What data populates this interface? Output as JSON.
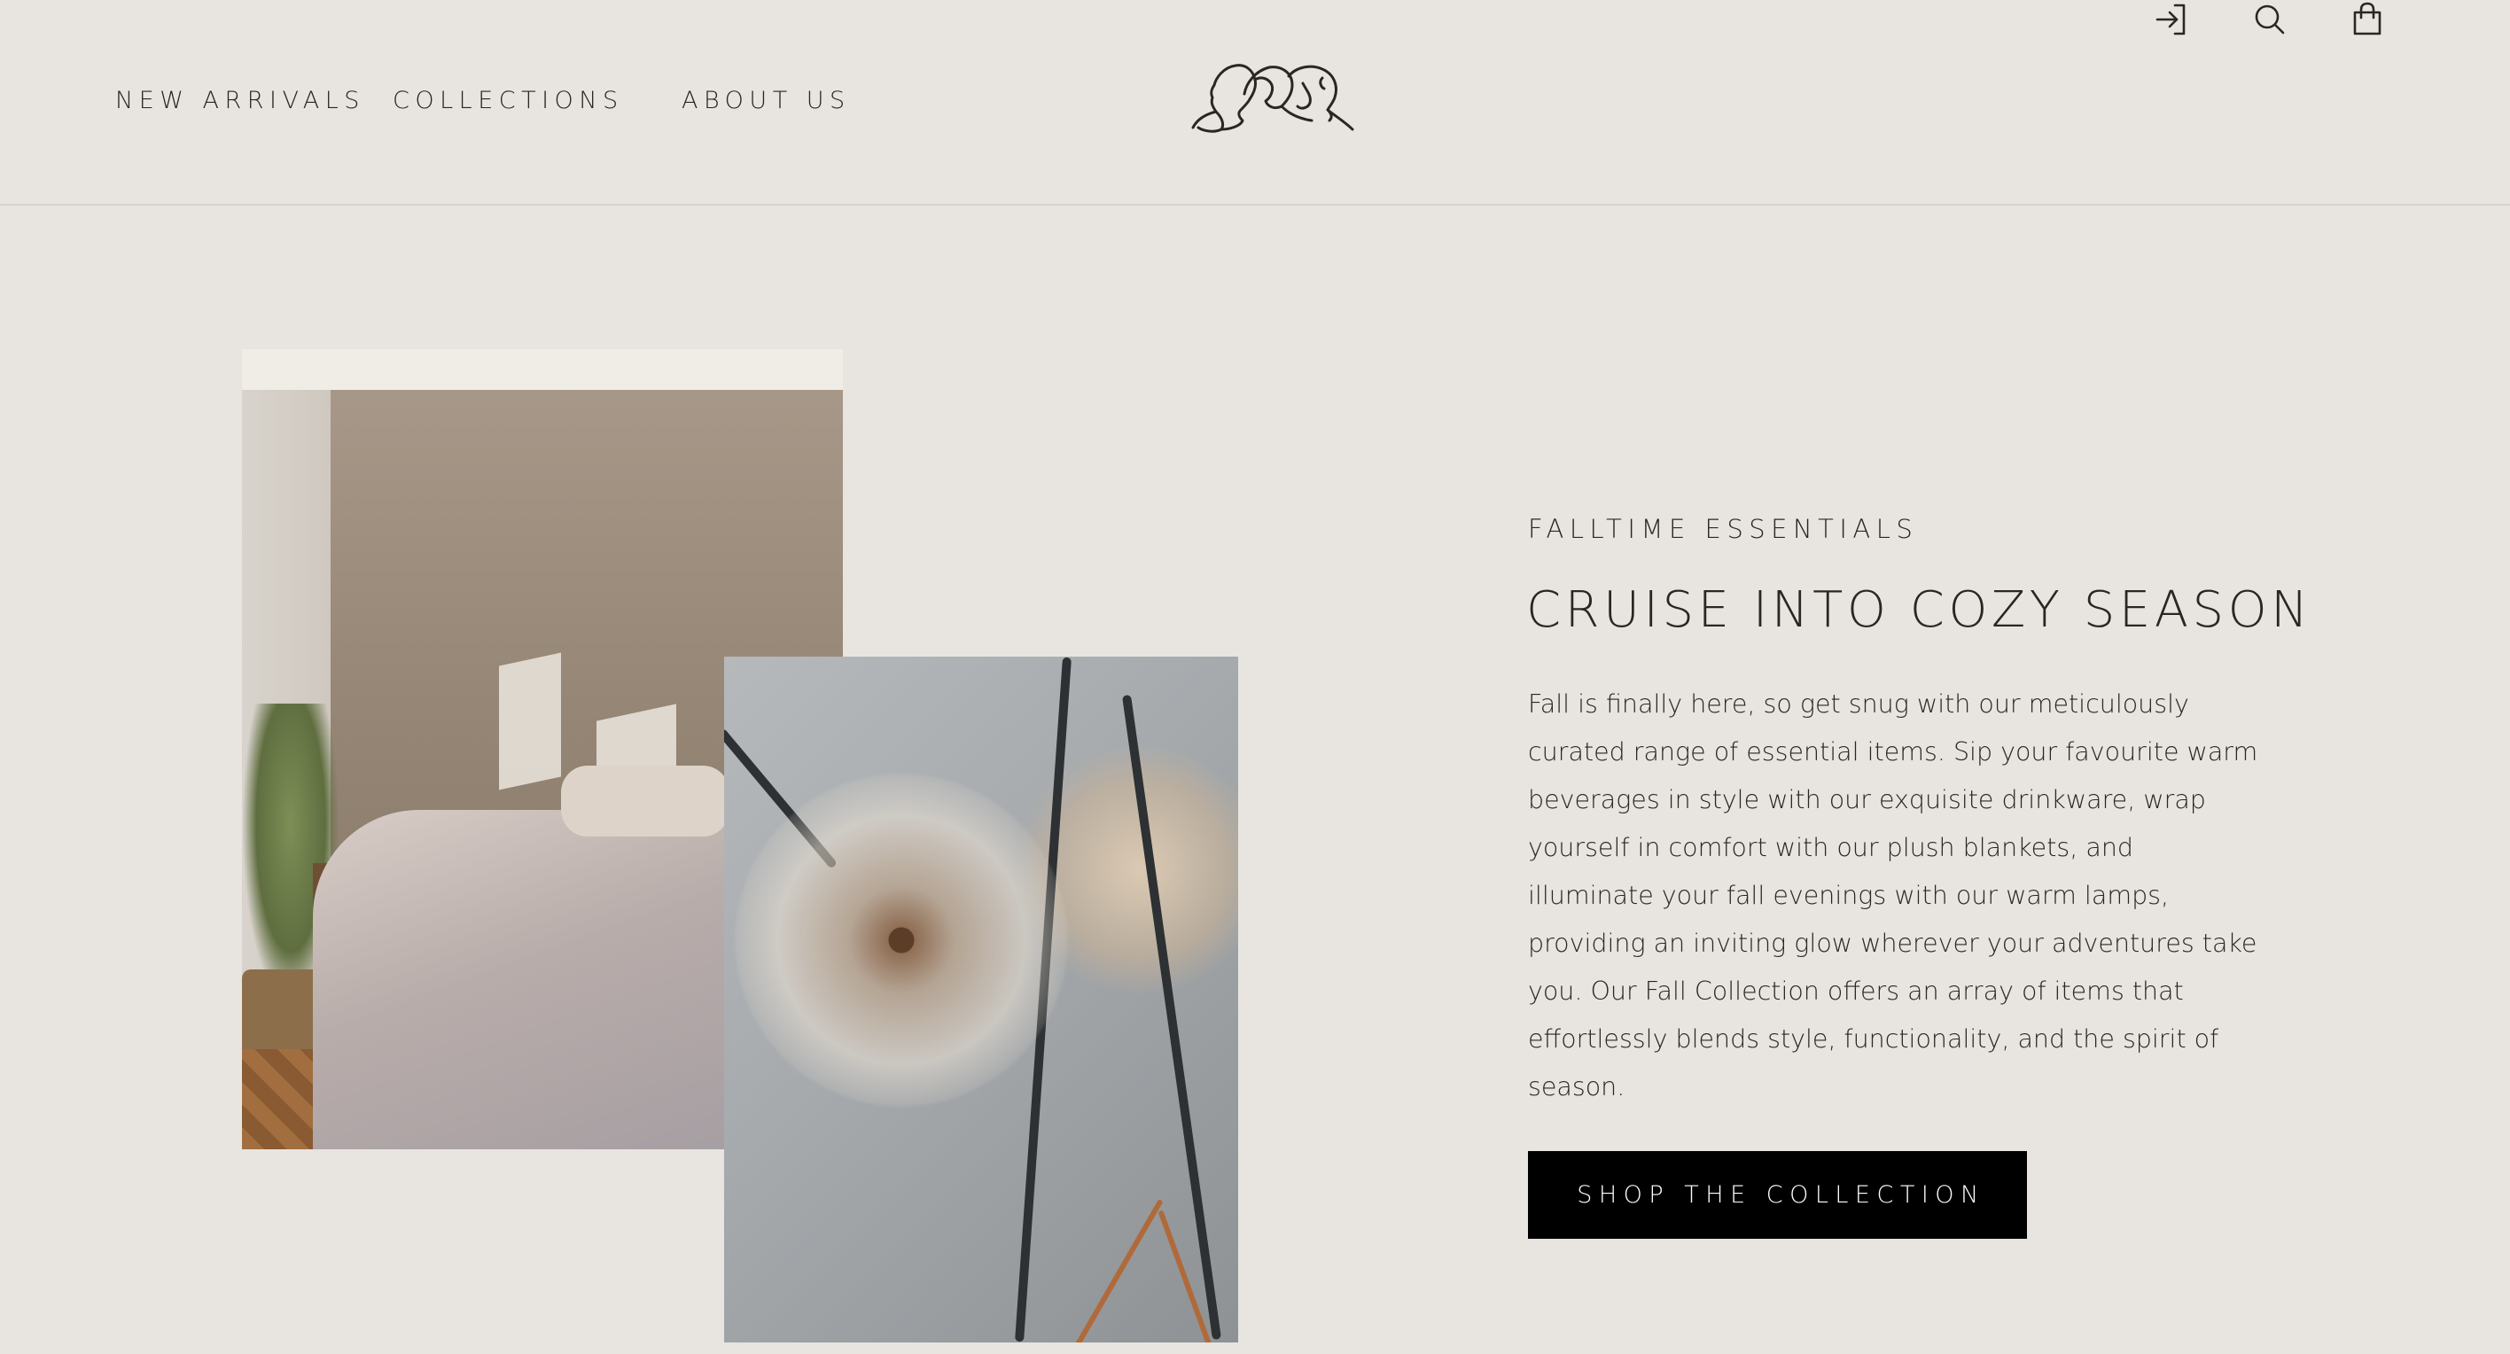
{
  "nav": {
    "items": [
      {
        "label": "NEW ARRIVALS"
      },
      {
        "label": "COLLECTIONS"
      },
      {
        "label": "ABOUT US"
      }
    ]
  },
  "header": {
    "icons": [
      "login-icon",
      "search-icon",
      "shopping-bag-icon"
    ],
    "logo": "faces-line-art-logo"
  },
  "hero": {
    "eyebrow": "FALLTIME ESSENTIALS",
    "headline": "CRUISE INTO COZY SEASON",
    "body": "Fall is finally here, so get snug with our meticulously curated range of essential items. Sip your favourite warm beverages in style with our exquisite drinkware, wrap yourself in comfort with our plush blankets, and illuminate your fall evenings with our warm lamps, providing an inviting glow wherever your adventures take you. Our Fall Collection offers an array of items that effortlessly blends style, functionality, and the spirit of season.",
    "cta_label": "SHOP THE COLLECTION"
  },
  "colors": {
    "background": "#e8e5e0",
    "text": "#2a2624",
    "cta_background": "#000000",
    "cta_text": "#ffffff"
  }
}
